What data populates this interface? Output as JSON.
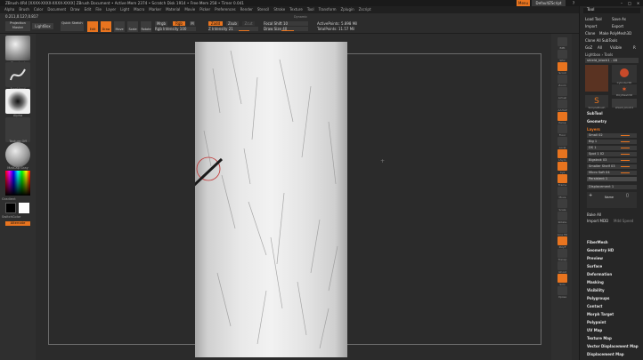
{
  "window": {
    "title": "ZBrush 4R4 [XXXX-XXXX-XXXX-XXXX]   ZBrush Document   • Active Mem 2374 • Scratch Disk 1914 • Free Mem 258 • Timer 0.041",
    "menu_button": "Menu",
    "default_script": "DefaultZScript"
  },
  "menu": [
    "Alpha",
    "Brush",
    "Color",
    "Document",
    "Draw",
    "Edit",
    "File",
    "Layer",
    "Light",
    "Macro",
    "Marker",
    "Material",
    "Movie",
    "Picker",
    "Preferences",
    "Render",
    "Stencil",
    "Stroke",
    "Texture",
    "Tool",
    "Transform",
    "Zplugin",
    "Zscript"
  ],
  "topbar": {
    "coords": "0.211,0.127,0.817",
    "projection_master": "Projection Master",
    "lightbox": "LightBox",
    "quick_sketch": "Quick Sketch",
    "mode_buttons": [
      "Edit",
      "Draw",
      "Move",
      "Scale",
      "Rotate"
    ],
    "mrgb": "Mrgb",
    "rgb": "Rgb",
    "m": "M",
    "rgb_intensity": "Rgb Intensity 100",
    "zadd": "Zadd",
    "zsub": "Zsub",
    "zcut": "Zcut",
    "z_intensity": "Z Intensity 21",
    "focal_shift": "Focal Shift 10",
    "draw_size": "Draw Size 40",
    "dynamic": "Dynamic",
    "active_points": "ActivePoints: 5.898 Mil",
    "total_points": "TotalPoints: 11.57 Mil"
  },
  "left_shelf": {
    "brush_label": "Standard",
    "stroke_label": "FreeHand",
    "alpha_label": "Alpha",
    "texture_label": "Texture Off",
    "material_label": "MatCap Gray",
    "gradient_label": "Gradient",
    "switch_color": "SwitchColor",
    "alternate": "Alternate"
  },
  "right_icons": [
    "BPR",
    "SPix",
    "Scroll",
    "Zoom",
    "Actual",
    "AAHalf",
    "Persp",
    "Floor",
    "Local",
    "LSym",
    "Xyz",
    "Frame",
    "Move",
    "Scale",
    "Rotate",
    "Line Fill",
    "PolyF",
    "Transp",
    "Ghost",
    "Solo",
    "Xpose"
  ],
  "tool_panel": {
    "title": "Tool",
    "load_tool": "Load Tool",
    "save_as": "Save As",
    "import": "Import",
    "export": "Export",
    "clone": "Clone",
    "make_polymesh": "Make PolyMesh3D",
    "goz": "GoZ",
    "all": "All",
    "visible": "Visible",
    "r": "R",
    "clone_all_subtools": "Clone All SubTools",
    "lightbox_tools": "Lightbox › Tools",
    "current_tool": "shield_block1 . 48",
    "tool_thumbs": [
      "shield_block1",
      "Cylinder3D",
      "PolyMesh3D",
      "SimpleBrush",
      "shield_block1"
    ],
    "subtool": "SubTool",
    "geometry": "Geometry",
    "layers": "Layers",
    "layer_rows": [
      "Small 02",
      "Big 1",
      "DS 1",
      "Spot 1 02",
      "Bigstrok 03",
      "Smaller Shelf 03",
      "Micro Soft 04",
      "Persistent 1"
    ],
    "displacement": "Displacement 1",
    "layer_buttons": [
      "Name",
      "Bake All",
      "Import MDD",
      "Mdd Speed"
    ],
    "sections": [
      "FiberMesh",
      "Geometry HD",
      "Preview",
      "Surface",
      "Deformation",
      "Masking",
      "Visibility",
      "Polygroups",
      "Contact",
      "Morph Target",
      "Polypaint",
      "UV Map",
      "Texture Map",
      "Vector Displacement Map",
      "Displacement Map",
      "Normal Map"
    ]
  }
}
